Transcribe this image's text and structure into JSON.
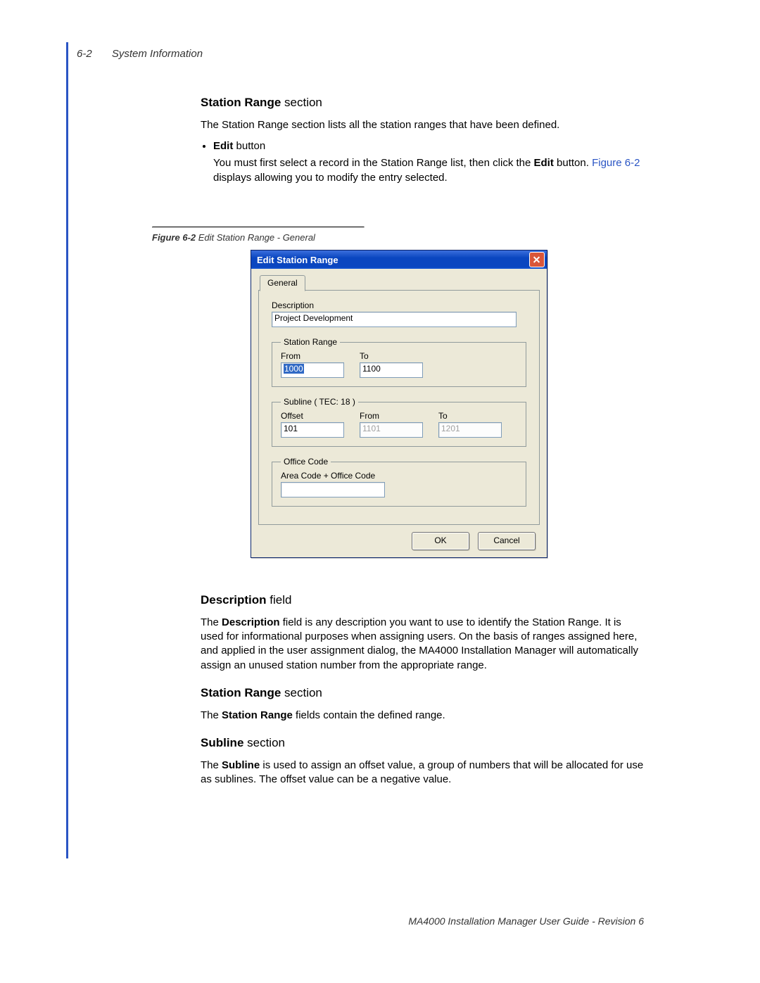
{
  "header": {
    "page_number": "6-2",
    "section": "System Information"
  },
  "sec1": {
    "heading_bold": "Station Range",
    "heading_rest": " section",
    "para": "The Station Range section lists all the station ranges that have been defined.",
    "bullet_bold": "Edit",
    "bullet_rest": " button",
    "bullet_desc_pre": "You must first select a record in the Station Range list, then click the ",
    "bullet_desc_bold": "Edit",
    "bullet_desc_mid": " button. ",
    "bullet_desc_xref": "Figure 6-2",
    "bullet_desc_post": " displays allowing you to modify the entry selected."
  },
  "figure": {
    "caption_bold": "Figure 6-2",
    "caption_rest": "  Edit Station Range - General"
  },
  "dialog": {
    "title": "Edit Station Range",
    "tab": "General",
    "description_label": "Description",
    "description_value": "Project Development",
    "station_range": {
      "legend": "Station Range",
      "from_label": "From",
      "from_value": "1000",
      "to_label": "To",
      "to_value": "1100"
    },
    "subline": {
      "legend": "Subline ( TEC: 18 )",
      "offset_label": "Offset",
      "offset_value": "101",
      "from_label": "From",
      "from_value": "1101",
      "to_label": "To",
      "to_value": "1201"
    },
    "office_code": {
      "legend": "Office Code",
      "label": "Area Code + Office Code",
      "value": ""
    },
    "ok": "OK",
    "cancel": "Cancel"
  },
  "sec2": {
    "heading_bold": "Description",
    "heading_rest": " field",
    "para_pre": "The ",
    "para_bold": "Description",
    "para_post": " field is any description you want to use to identify the Station Range. It is used for informational purposes when assigning users. On the basis of ranges assigned here, and applied in the user assignment dialog, the MA4000 Installation Manager will automatically assign an unused station number from the appropriate range."
  },
  "sec3": {
    "heading_bold": "Station Range",
    "heading_rest": " section",
    "para_pre": "The ",
    "para_bold": "Station Range",
    "para_post": " fields contain the defined range."
  },
  "sec4": {
    "heading_bold": "Subline",
    "heading_rest": " section",
    "para_pre": "The ",
    "para_bold": "Subline",
    "para_post": " is used to assign an offset value, a group of numbers that will be allocated for use as sublines. The offset value can be a negative value."
  },
  "footer": "MA4000 Installation Manager User Guide - Revision 6"
}
